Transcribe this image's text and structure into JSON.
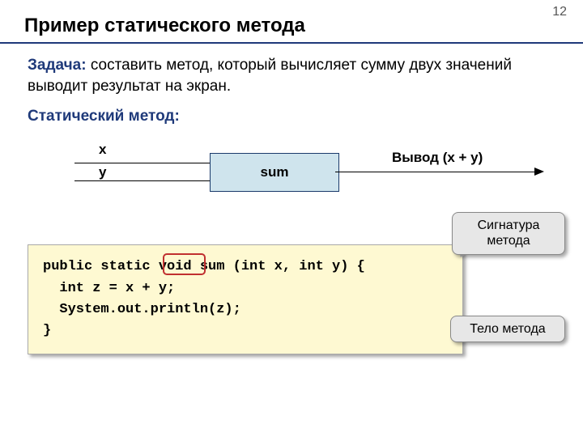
{
  "page_number": "12",
  "title": "Пример статического метода",
  "task": {
    "label": "Задача:",
    "text": " составить метод, который вычисляет сумму двух значений выводит результат на экран."
  },
  "static_method_label": "Статический метод:",
  "diagram": {
    "x_label": "x",
    "y_label": "y",
    "box_label": "sum",
    "out_label": "Вывод (x + y)"
  },
  "code": "public static void sum (int x, int y) {\n  int z = x + y;\n  System.out.println(z);\n}",
  "callouts": {
    "signature": "Сигнатура метода",
    "body": "Тело метода"
  }
}
